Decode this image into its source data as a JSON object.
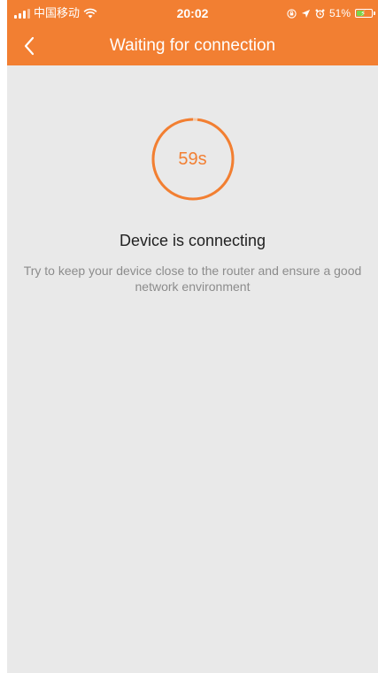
{
  "status_bar": {
    "carrier": "中国移动",
    "time": "20:02",
    "battery_percent": "51%",
    "battery_level": 0.51
  },
  "nav": {
    "title": "Waiting for connection",
    "back_icon": "chevron-left-icon"
  },
  "countdown": {
    "label": "59s",
    "progress": 0.98
  },
  "status": {
    "title": "Device is connecting",
    "description": "Try to keep your device close to the router and ensure a good network environment"
  },
  "colors": {
    "accent": "#f27f32",
    "accent_light": "#f3c7a5",
    "background": "#e9e9e9",
    "title_text": "#222222",
    "desc_text": "#8c8c8c"
  }
}
